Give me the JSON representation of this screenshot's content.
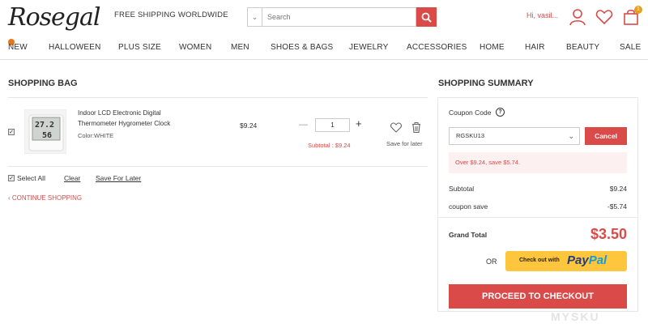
{
  "header": {
    "logo_text": "Rosegal",
    "shipping_text": "FREE SHIPPING WORLDWIDE",
    "search": {
      "placeholder": "Search",
      "category_icon": "chevron-down-icon",
      "button_icon": "search-icon"
    },
    "greeting": "Hi, vasil...",
    "cart_count": "1"
  },
  "nav": [
    "NEW",
    "HALLOWEEN",
    "PLUS SIZE",
    "WOMEN",
    "MEN",
    "SHOES & BAGS",
    "JEWELRY",
    "ACCESSORIES",
    "HOME",
    "HAIR",
    "BEAUTY",
    "SALE"
  ],
  "bag": {
    "title": "SHOPPING BAG",
    "item": {
      "name": "Indoor LCD Electronic Digital Thermometer Hygrometer Clock",
      "color": "Color:WHITE",
      "price": "$9.24",
      "quantity": "1",
      "subtotal": "Subtotal :  $9.24",
      "save_for_later": "Save for later",
      "display_temp": "27.2",
      "display_hum": "56"
    },
    "select_all": "Select All",
    "clear": "Clear",
    "save_for_later": "Save For Later",
    "continue_shopping": "CONTINUE SHOPPING"
  },
  "summary": {
    "title": "SHOPPING SUMMARY",
    "coupon_label": "Coupon Code",
    "coupon_value": "RGSKU13",
    "cancel_label": "Cancel",
    "promo_message": "Over $9.24, save $5.74.",
    "subtotal_label": "Subtotal",
    "subtotal_value": "$9.24",
    "coupon_save_label": "coupon save",
    "coupon_save_value": "-$5.74",
    "grand_total_label": "Grand Total",
    "grand_total_value": "$3.50",
    "or_label": "OR",
    "paypal_text": "Check out with",
    "paypal_brand_1": "Pay",
    "paypal_brand_2": "Pal",
    "checkout_label": "PROCEED TO CHECKOUT"
  },
  "watermark": "MYSKU",
  "colors": {
    "accent": "#d94a48",
    "paypal": "#fdc63d"
  }
}
